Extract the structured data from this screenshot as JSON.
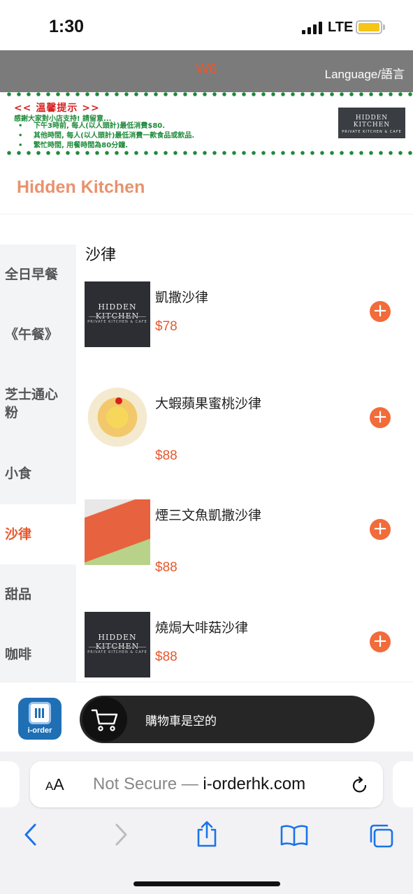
{
  "status_bar": {
    "time": "1:30",
    "network": "LTE",
    "battery_color": "#f5c518"
  },
  "header": {
    "table_no": "W6",
    "language_label": "Language/語言",
    "background": "#7b7b7b",
    "accent": "#e8582c"
  },
  "notice": {
    "title": "<< 溫馨提示 >>",
    "intro": "感謝大家對小店支持! 請留意...",
    "items": [
      "下午3時前, 每人(以人頭計)最低消費$80.",
      "其他時間, 每人(以人頭計)最低消費一款食品或飲品.",
      "繁忙時間, 用餐時間為80分鐘."
    ],
    "logo_line1": "HIDDEN KITCHEN",
    "logo_line2": "PRIVATE KITCHEN & CAFE"
  },
  "restaurant": {
    "name": "Hidden Kitchen",
    "name_color": "#e8926e"
  },
  "categories": [
    {
      "label": "全日早餐",
      "active": false
    },
    {
      "label": "《午餐》",
      "active": false
    },
    {
      "label": "芝士通心粉",
      "active": false
    },
    {
      "label": "小食",
      "active": false
    },
    {
      "label": "沙律",
      "active": true
    },
    {
      "label": "甜品",
      "active": false
    },
    {
      "label": "咖啡",
      "active": false
    }
  ],
  "section": {
    "title": "沙律",
    "items": [
      {
        "name": "凱撒沙律",
        "price": "$78",
        "image": "hidden-kitchen-logo-image",
        "image_text1": "HIDDEN KITCHEN",
        "image_text2": "PRIVATE KITCHEN & CAFE"
      },
      {
        "name": "大蝦蘋果蜜桃沙律",
        "price": "$88",
        "image": "shrimp-salad-photo"
      },
      {
        "name": "煙三文魚凱撒沙律",
        "price": "$88",
        "image": "smoked-salmon-salad-photo"
      },
      {
        "name": "燒焗大啡菇沙律",
        "price": "$88",
        "image": "hidden-kitchen-logo-image",
        "image_text1": "HIDDEN KITCHEN",
        "image_text2": "PRIVATE KITCHEN & CAFE"
      }
    ],
    "add_icon": "plus-circle-icon"
  },
  "cart": {
    "logo_text": "i-order",
    "empty_text": "購物車是空的",
    "cart_icon": "cart-icon"
  },
  "browser": {
    "text_size": "AA",
    "not_secure": "Not Secure —",
    "domain": "i-orderhk.com"
  }
}
